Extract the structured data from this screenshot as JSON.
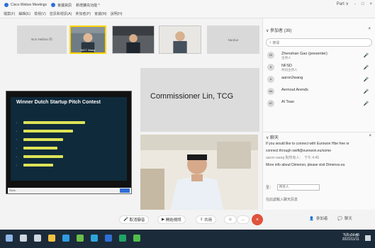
{
  "window": {
    "tabs": [
      {
        "label": "Cisco Webex Meetings",
        "active": true
      },
      {
        "label": "會議資訊",
        "active": false
      },
      {
        "label": "新增擴充功能 ^",
        "active": false
      }
    ],
    "controls": {
      "participant_count": "Part ∨",
      "minimize": "-",
      "maximize": "□",
      "close": "×"
    }
  },
  "menu": [
    "檔案(F)",
    "編輯(E)",
    "檢視(V)",
    "音訊和視訊(A)",
    "參加者(P)",
    "會議(M)",
    "說明(H)"
  ],
  "stage": {
    "thumbnails": [
      {
        "label": "Bon Nathan 的",
        "type": "gray"
      },
      {
        "label": "NICT Wang",
        "type": "person",
        "active": true
      },
      {
        "label": "",
        "type": "person"
      },
      {
        "label": "",
        "type": "person"
      },
      {
        "label": "Nardue",
        "type": "gray"
      }
    ],
    "featured_name": "Commissioner Lin, TCG",
    "shared_title": "Winner Dutch Startup Pitch Contest",
    "shared_bars": [
      0.62,
      0.5,
      0.4,
      0.34,
      0.4,
      0.3
    ],
    "share_footer": "Slido"
  },
  "panel": {
    "header": "∨ 參加者 (39)",
    "close": "×",
    "search_placeholder": "搜尋",
    "participants": [
      {
        "initials": "ZS",
        "name": "Zhenshan Gao (presenter)",
        "note": "主持人",
        "mic": "🎤"
      },
      {
        "initials": "N",
        "name": "NFSD",
        "note": "共同主持人",
        "mic": "🎤"
      },
      {
        "initials": "A",
        "name": "aaron2wang",
        "note": "",
        "mic": "🎤"
      },
      {
        "initials": "AA",
        "name": "Aernout Arends",
        "note": "",
        "mic": "🎤"
      },
      {
        "initials": "AT",
        "name": "Al Tsao",
        "note": "",
        "mic": "🎤"
      }
    ],
    "chat_header": "∨ 聊天",
    "chat_lines": [
      "If you would like to connect with Eurowon Hbe free or",
      "connect through swift@eurowon.eu/some",
      "aaron wang 對所有人： 下午 4:45",
      "More info about Dimenso, please visit Dimenso.eu"
    ],
    "chat_to_label": "至：",
    "chat_to_value": "所有人",
    "chat_hint": "在此處輸入聊天訊息"
  },
  "controls": {
    "mute": "取消靜音",
    "video": "開始視訊",
    "share": "共用",
    "more": "…",
    "end": "×",
    "participants": "參加者",
    "chat": "聊天"
  },
  "taskbar": {
    "time": "下午 04:45",
    "date": "2021/11/11"
  }
}
